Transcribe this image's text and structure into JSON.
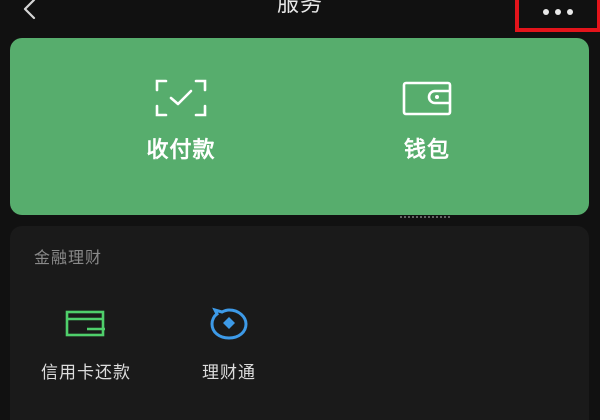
{
  "header": {
    "title": "服务",
    "back_icon": "chevron-left-icon",
    "more_icon": "more-dots-icon"
  },
  "colors": {
    "background": "#111111",
    "card_green": "#57ad6d",
    "section_bg": "#1a1a1a",
    "highlight_border": "#e3141b",
    "credit_icon": "#4fcf6b",
    "wealth_icon": "#3d9ae8"
  },
  "main_actions": [
    {
      "label": "收付款",
      "icon": "scan-check-icon"
    },
    {
      "label": "钱包",
      "icon": "wallet-icon"
    }
  ],
  "finance": {
    "title": "金融理财",
    "items": [
      {
        "label": "信用卡还款",
        "icon": "credit-card-icon"
      },
      {
        "label": "理财通",
        "icon": "wealth-icon"
      }
    ]
  }
}
